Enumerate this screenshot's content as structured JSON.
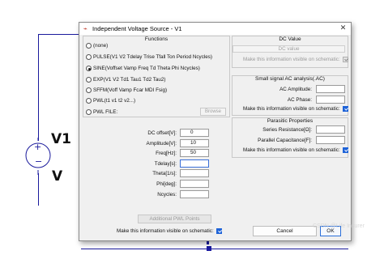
{
  "schematic": {
    "source_name": "V1",
    "source_value": "V",
    "plus_sign": "+",
    "minus_sign": "−"
  },
  "dialog": {
    "title": "Independent Voltage Source - V1",
    "close_glyph": "✕",
    "icon_glyph": "⌁"
  },
  "functions": {
    "title": "Functions",
    "options": [
      {
        "label": "(none)",
        "selected": false
      },
      {
        "label": "PULSE(V1 V2 Tdelay Trise Tfall Ton Period Ncycles)",
        "selected": false
      },
      {
        "label": "SINE(Voffset Vamp Freq Td Theta Phi Ncycles)",
        "selected": true
      },
      {
        "label": "EXP(V1 V2 Td1 Tau1 Td2 Tau2)",
        "selected": false
      },
      {
        "label": "SFFM(Voff Vamp Fcar MDI Fsig)",
        "selected": false
      },
      {
        "label": "PWL(t1 v1 t2 v2...)",
        "selected": false
      },
      {
        "label": "PWL FILE:",
        "selected": false
      }
    ],
    "browse_label": "Browse"
  },
  "params": [
    {
      "label": "DC offset[V]:",
      "value": "0"
    },
    {
      "label": "Amplitude[V]:",
      "value": "10"
    },
    {
      "label": "Freq[Hz]:",
      "value": "50"
    },
    {
      "label": "Tdelay[s]:",
      "value": ""
    },
    {
      "label": "Theta[1/s]:",
      "value": ""
    },
    {
      "label": "Phi[deg]:",
      "value": ""
    },
    {
      "label": "Ncycles:",
      "value": ""
    }
  ],
  "additional_pwl_label": "Additional PWL Points",
  "bottom_visible_label": "Make this information visible on schematic:",
  "dc_value": {
    "title": "DC Value",
    "placeholder": "DC value",
    "visible_label": "Make this information visible on schematic:"
  },
  "small_signal": {
    "title": "Small signal AC analysis(.AC)",
    "ac_amplitude_label": "AC Amplitude:",
    "ac_phase_label": "AC Phase:",
    "visible_label": "Make this information visible on schematic:"
  },
  "parasitic": {
    "title": "Parasitic Properties",
    "series_resistance_label": "Series Resistance[Ω]:",
    "parallel_capacitance_label": "Parallel Capacitance[F]:",
    "visible_label": "Make this information visible on schematic:"
  },
  "buttons": {
    "cancel": "Cancel",
    "ok": "OK"
  },
  "watermark": "CSDN @Life Insurer",
  "colors": {
    "wire": "#1a1a9c",
    "checkbox_checked": "#1e63d8",
    "ok_border": "#2b6fd8"
  }
}
